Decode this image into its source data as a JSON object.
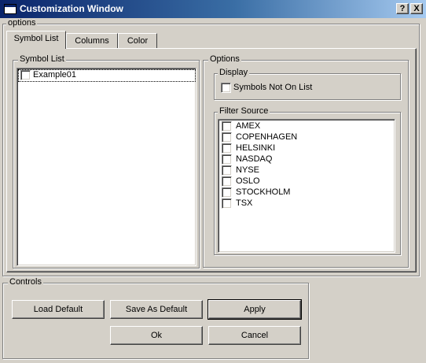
{
  "window": {
    "title": "Customization Window",
    "help_label": "?",
    "close_label": "X"
  },
  "options_group": {
    "label": "options",
    "tabs": [
      {
        "label": "Symbol List",
        "active": true
      },
      {
        "label": "Columns",
        "active": false
      },
      {
        "label": "Color",
        "active": false
      }
    ],
    "symbol_list": {
      "label": "Symbol List",
      "items": [
        {
          "label": "Example01",
          "checked": false
        }
      ]
    },
    "options": {
      "label": "Options",
      "display": {
        "label": "Display",
        "symbols_not_on_list_label": "Symbols Not On List",
        "symbols_not_on_list_checked": false
      },
      "filter_source": {
        "label": "Filter Source",
        "items": [
          {
            "label": "AMEX",
            "checked": false
          },
          {
            "label": "COPENHAGEN",
            "checked": false
          },
          {
            "label": "HELSINKI",
            "checked": false
          },
          {
            "label": "NASDAQ",
            "checked": false
          },
          {
            "label": "NYSE",
            "checked": false
          },
          {
            "label": "OSLO",
            "checked": false
          },
          {
            "label": "STOCKHOLM",
            "checked": false
          },
          {
            "label": "TSX",
            "checked": false
          }
        ]
      }
    }
  },
  "controls": {
    "label": "Controls",
    "load_default_label": "Load Default",
    "save_as_default_label": "Save As Default",
    "apply_label": "Apply",
    "ok_label": "Ok",
    "cancel_label": "Cancel"
  }
}
